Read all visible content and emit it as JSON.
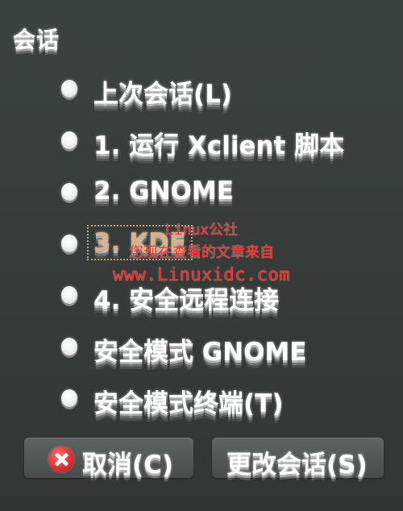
{
  "dialog": {
    "title": "会话"
  },
  "sessions": [
    {
      "label": "上次会话(L)",
      "selected": false
    },
    {
      "label": "1. 运行 Xclient 脚本",
      "selected": false
    },
    {
      "label": "2. GNOME",
      "selected": false
    },
    {
      "label": "3. KDE",
      "selected": true
    },
    {
      "label": "4. 安全远程连接",
      "selected": false
    },
    {
      "label": "安全模式 GNOME",
      "selected": false
    },
    {
      "label": "安全模式终端(T)",
      "selected": false
    }
  ],
  "watermark": {
    "line1": "Linux公社",
    "line2": "您现在查看的文章来自",
    "line3": "www.Linuxidc.com"
  },
  "buttons": {
    "cancel_label": "取消(C)",
    "change_label": "更改会话(S)"
  },
  "icons": {
    "radio": "radio-icon",
    "cancel": "cancel-icon"
  },
  "colors": {
    "background": "#3a3f3d",
    "text": "#ffffff",
    "selected_text": "#d9b088",
    "cancel_icon": "#e23030",
    "watermark": "#ff2222"
  }
}
